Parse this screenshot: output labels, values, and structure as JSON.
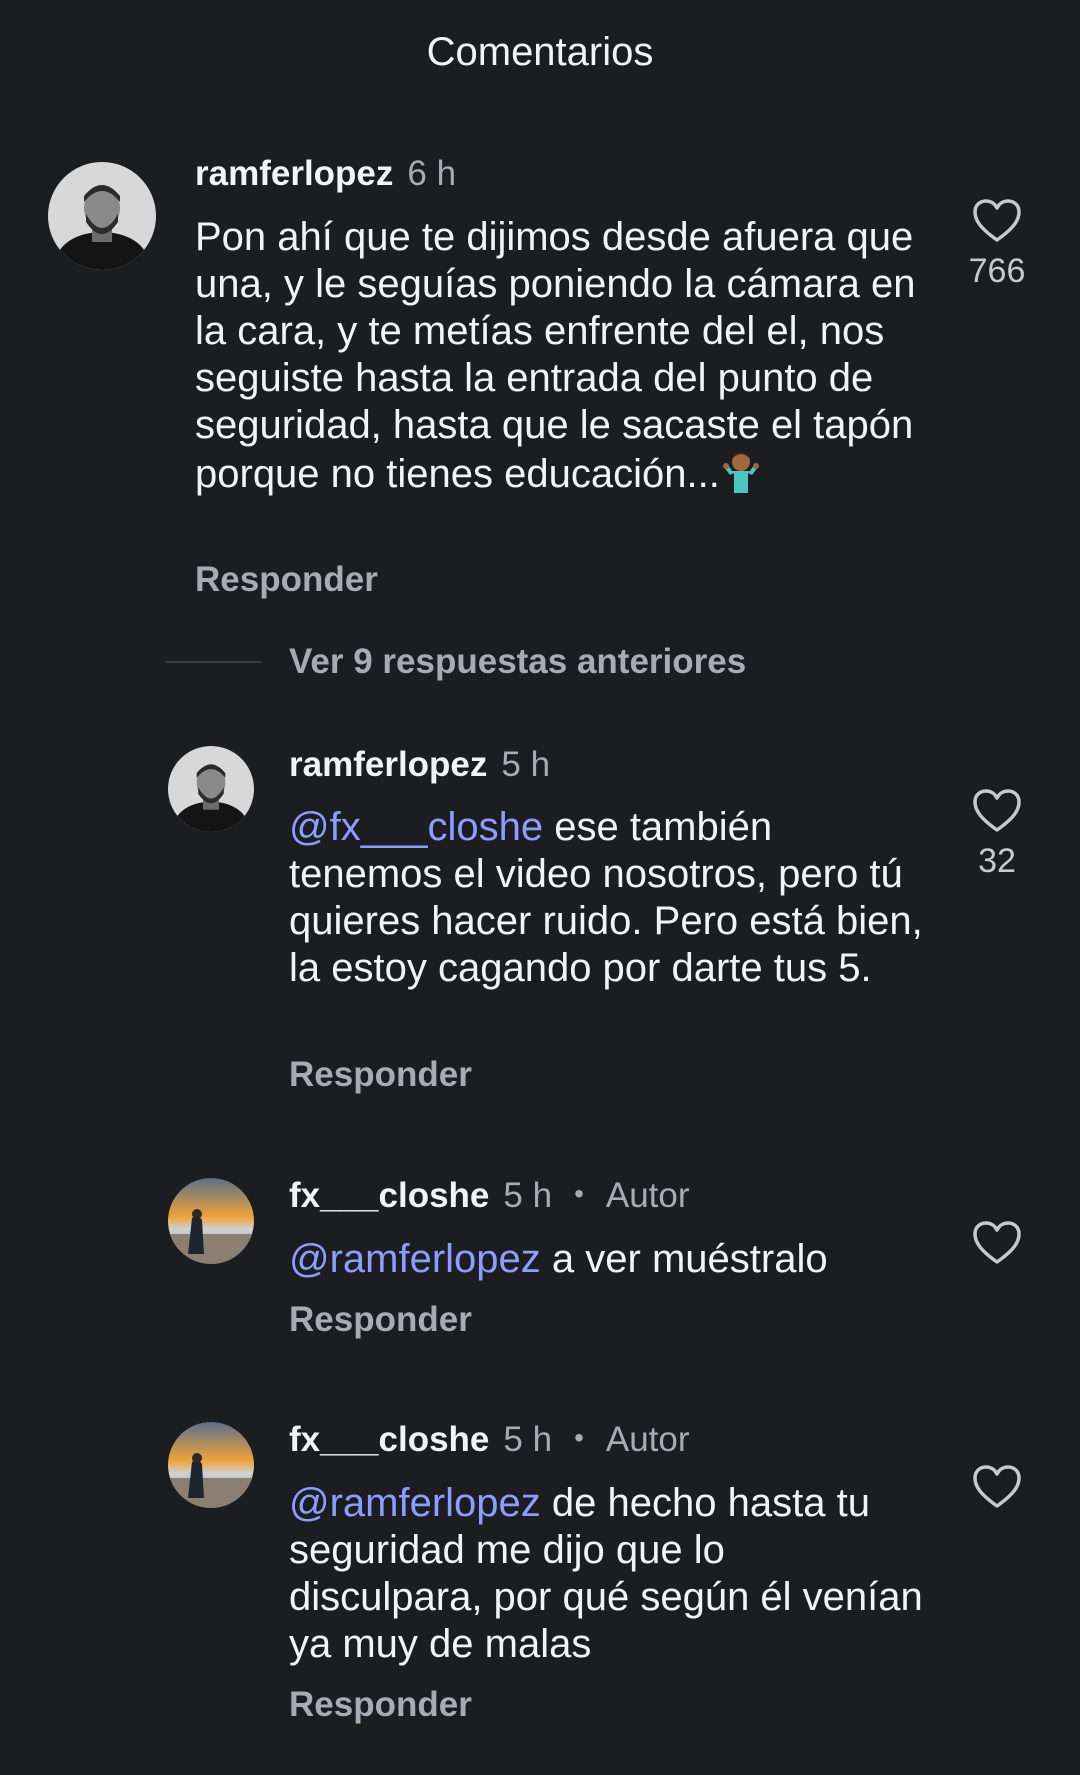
{
  "header": {
    "title": "Comentarios"
  },
  "comments": [
    {
      "username": "ramferlopez",
      "time": "6 h",
      "text": "Pon ahí que te dijimos desde afuera que una, y le seguías poniendo la cámara en la cara, y te metías enfrente del el, nos seguiste hasta la entrada del punto de seguridad, hasta que le sacaste el tapón porque no tienes educación...",
      "emoji": "person-shrugging",
      "likes": "766",
      "reply_label": "Responder"
    }
  ],
  "view_previous": "Ver 9 respuestas anteriores",
  "replies": [
    {
      "username": "ramferlopez",
      "time": "5 h",
      "mention": "@fx___closhe",
      "text": " ese también tenemos el video nosotros, pero tú quieres hacer ruido. Pero está bien, la estoy cagando por darte tus 5.",
      "likes": "32",
      "reply_label": "Responder"
    },
    {
      "username": "fx___closhe",
      "time": "5 h",
      "dot": "•",
      "author_label": "Autor",
      "mention": "@ramferlopez",
      "text": " a ver muéstralo",
      "reply_label": "Responder"
    },
    {
      "username": "fx___closhe",
      "time": "5 h",
      "dot": "•",
      "author_label": "Autor",
      "mention": "@ramferlopez",
      "text": " de hecho hasta tu seguridad me dijo que lo disculpara, por qué según él venían ya muy de malas",
      "reply_label": "Responder"
    }
  ],
  "icons": {
    "like": "heart-outline-icon",
    "mention": "threads-at-icon"
  },
  "colors": {
    "background": "#1c1d21",
    "mention": "#8c9dff",
    "secondary_text": "#a8abb3"
  }
}
